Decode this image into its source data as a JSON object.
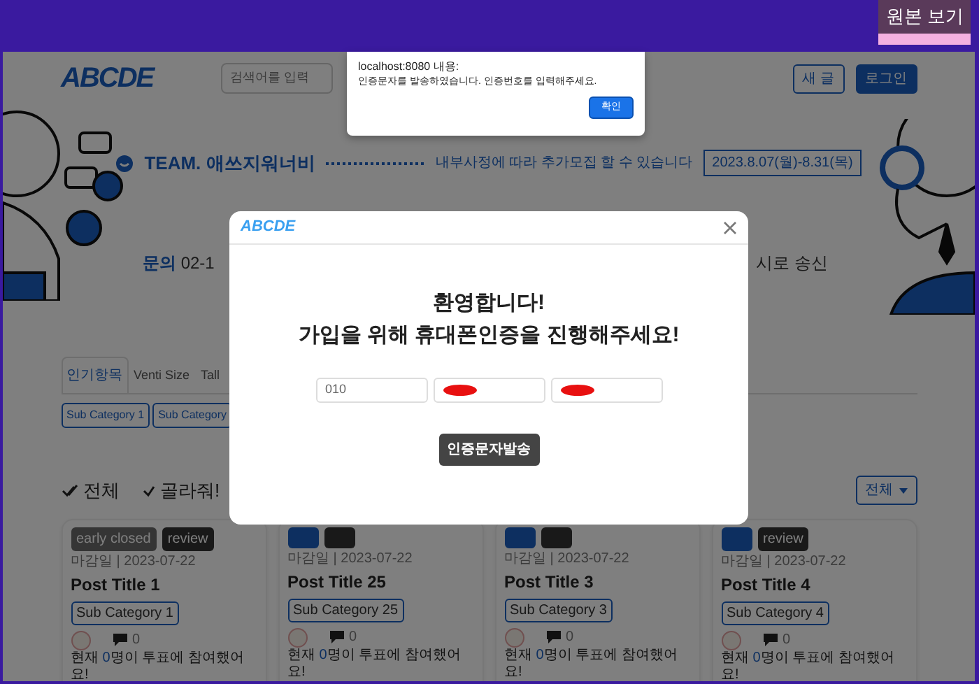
{
  "frame": {
    "badge": "원본 보기"
  },
  "header": {
    "logo": "ABCDE",
    "search_placeholder": "검색어를 입력",
    "buttons": [
      {
        "label": "새 글",
        "kind": "outline"
      },
      {
        "label": "로그인",
        "kind": "solid"
      }
    ]
  },
  "banner": {
    "team": "TEAM. 애쓰지워너비",
    "notice": "내부사정에 따라 추가모집 할 수 있습니다",
    "period": "2023.8.07(월)-8.31(목)",
    "contact_label": "문의",
    "contact": "02-1",
    "contact_tail": "시로 송신"
  },
  "tabs": [
    {
      "label": "인기항목",
      "selected": true
    },
    {
      "label": "Venti Size",
      "selected": false
    },
    {
      "label": "Tall",
      "selected": false
    }
  ],
  "sub_categories": [
    "Sub Category 1",
    "Sub Category"
  ],
  "filters": [
    {
      "label": "전체",
      "selected": true
    },
    {
      "label": "골라줘!",
      "selected": false
    }
  ],
  "sort_dropdown": "전체",
  "cards": [
    {
      "badges": [
        {
          "label": "early closed",
          "kind": "grey"
        },
        {
          "label": "review",
          "kind": "dark"
        }
      ],
      "deadline": "마감일 | 2023-07-22",
      "title": "Post Title 1",
      "sub_category": "Sub Category 1",
      "comments": "0",
      "vote_before": "현재 ",
      "vote_count": "0",
      "vote_after": "명이 투표에 참여했어요!"
    },
    {
      "badges": [
        {
          "kind": "blue"
        },
        {
          "kind": "dark"
        }
      ],
      "deadline": "마감일 | 2023-07-22",
      "title": "Post Title 25",
      "sub_category": "Sub Category 25",
      "comments": "0",
      "vote_before": "현재 ",
      "vote_count": "0",
      "vote_after": "명이 투표에 참여했어요!"
    },
    {
      "badges": [
        {
          "kind": "blue"
        },
        {
          "kind": "dark"
        }
      ],
      "deadline": "마감일 | 2023-07-22",
      "title": "Post Title 3",
      "sub_category": "Sub Category 3",
      "comments": "0",
      "vote_before": "현재 ",
      "vote_count": "0",
      "vote_after": "명이 투표에 참여했어요!"
    },
    {
      "badges": [
        {
          "kind": "blue"
        },
        {
          "label": "review",
          "kind": "dark"
        }
      ],
      "deadline": "마감일 | 2023-07-22",
      "title": "Post Title 4",
      "sub_category": "Sub Category 4",
      "comments": "0",
      "vote_before": "현재 ",
      "vote_count": "0",
      "vote_after": "명이 투표에 참여했어요!"
    }
  ],
  "modal": {
    "logo": "ABCDE",
    "title": "환영합니다!",
    "subtitle": "가입을 위해 휴대폰인증을 진행해주세요!",
    "phone_fields": [
      {
        "value": "010",
        "redacted": false
      },
      {
        "redacted": true
      },
      {
        "redacted": true
      }
    ],
    "button": "인증문자발송"
  },
  "alert": {
    "origin": "localhost:8080 내용:",
    "message": "인증문자를 발송하였습니다. 인증번호를 입력해주세요.",
    "button": "확인"
  }
}
